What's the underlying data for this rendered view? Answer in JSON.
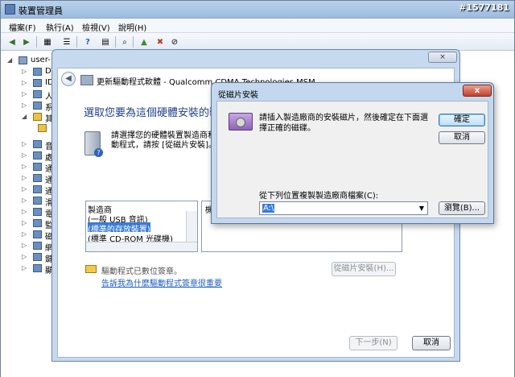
{
  "devmgr": {
    "title": "裝置管理員",
    "watermark": "#1577181",
    "menu": [
      "檔案(F)",
      "執行(A)",
      "檢視(V)",
      "說明(H)"
    ],
    "toolbar_icons": [
      "back-arrow-icon",
      "forward-arrow-icon",
      "properties-icon",
      "list-icon",
      "help-icon",
      "view-icon",
      "scan-icon",
      "update-driver-icon",
      "uninstall-icon",
      "disable-icon"
    ],
    "tree_root": "user-",
    "tree_items": [
      "DV",
      "ID",
      "人",
      "系",
      "其",
      "",
      "音",
      "處",
      "通",
      "通",
      "通",
      "滑",
      "電",
      "監",
      "磁",
      "網",
      "鍵",
      "顯"
    ]
  },
  "wizard": {
    "title": "更新驅動程式軟體 - Qualcomm CDMA Technologies MSM",
    "heading": "選取您要為這個硬體安裝的裝",
    "instruction_lines": [
      "請選擇您的硬體裝置製造商和",
      "動程式，請按 [從磁片安裝]。"
    ],
    "manufacturer_header": "製造商",
    "manufacturers": [
      "(一般 USB 音訊)",
      "(標準的存放裝置)",
      "(標準 CD-ROM 光碟機)"
    ],
    "selected_manufacturer": 1,
    "model_header": "機",
    "signed_text": "驅動程式已數位簽章。",
    "signing_link": "告訴我為什麼驅動程式簽章很重要",
    "have_disk_label": "從磁片安裝(H)...",
    "next_label": "下一步(N)",
    "cancel_label": "取消",
    "close_label": "×"
  },
  "disk_dialog": {
    "title": "從磁片安裝",
    "close_label": "x",
    "message": "請插入製造廠商的安裝磁片，然後確定在下面選擇正確的磁碟。",
    "ok_label": "確定",
    "cancel_label": "取消",
    "path_label": "從下列位置複製製造廠商檔案(C):",
    "path_value": "A:\\",
    "browse_label": "瀏覽(B)..."
  }
}
